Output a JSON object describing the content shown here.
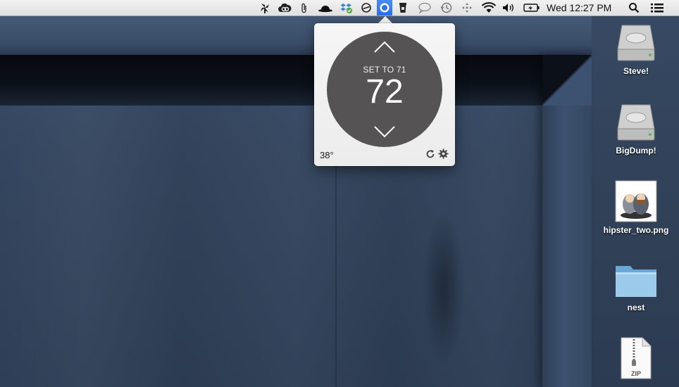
{
  "menubar": {
    "status_icons": [
      "pinwheel-icon",
      "creative-cloud-icon",
      "paperclip-icon",
      "bowler-hat-icon",
      "dropbox-icon",
      "circle-slash-icon",
      "nest-thermostat-icon",
      "coffee-cup-icon",
      "speech-bubble-icon",
      "time-machine-icon",
      "move-arrows-icon",
      "wifi-icon",
      "volume-icon",
      "battery-icon",
      "spotlight-search-icon",
      "notification-center-icon"
    ],
    "clock": "Wed 12:27 PM",
    "selected_color": "#2f72ea"
  },
  "thermostat": {
    "set_label": "SET TO 71",
    "current_temp": "72",
    "outdoor_temp": "38°",
    "dial_color": "#555353"
  },
  "desktop": {
    "items": [
      {
        "label": "Steve!",
        "icon": "hard-drive-icon"
      },
      {
        "label": "BigDump!",
        "icon": "hard-drive-icon"
      },
      {
        "label": "hipster_two.png",
        "icon": "image-thumbnail-icon"
      },
      {
        "label": "nest",
        "icon": "folder-icon"
      },
      {
        "label": "",
        "icon": "zip-archive-icon",
        "badge": "ZIP"
      }
    ]
  }
}
